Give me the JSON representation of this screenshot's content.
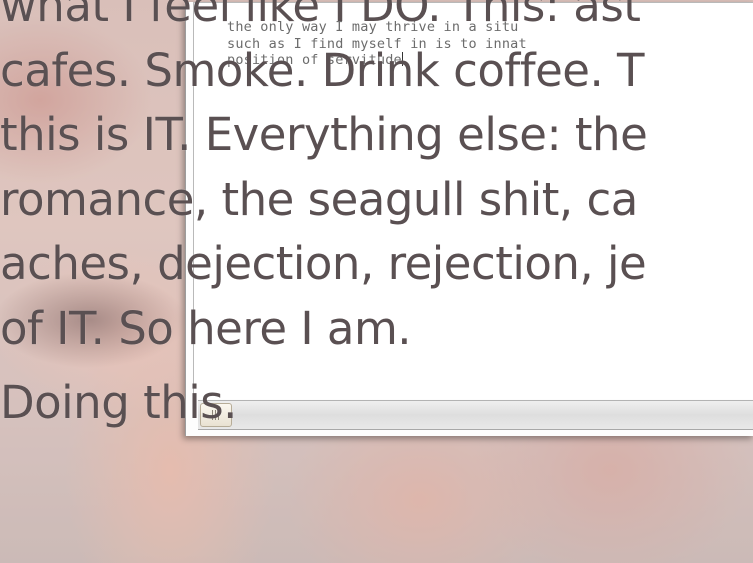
{
  "desktop_caption": {
    "lines": [
      "what I feel like I DO. This: ast",
      "cafes. Smoke. Drink coffee. T",
      "this is IT. Everything else: the",
      "romance, the seagull shit, ca",
      "aches, dejection, rejection, je",
      "of IT. So here I am."
    ],
    "last_line": "Doing this."
  },
  "editor": {
    "lines": [
      "the only way I may thrive in a situ",
      "such as I find myself in is to innat",
      "position of servitude"
    ]
  },
  "colors": {
    "caption_text": "#5a5052",
    "editor_text": "#6c6c6c",
    "editor_bg": "#ffffff",
    "scrollbar_thumb": "#e9e2d2"
  }
}
